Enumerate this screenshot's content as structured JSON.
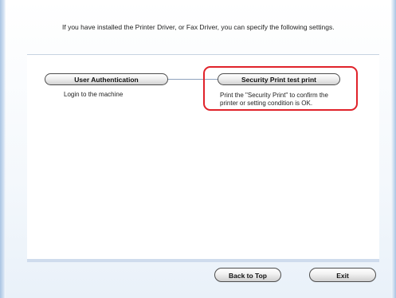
{
  "intro_text": "If you have installed the Printer Driver, or Fax Driver, you can specify the following settings.",
  "steps": [
    {
      "label": "User Authentication",
      "description": "Login to the machine"
    },
    {
      "label": "Security Print test print",
      "description": "Print the \"Security Print\" to confirm the printer or setting condition is OK."
    }
  ],
  "footer": {
    "back_label": "Back to Top",
    "exit_label": "Exit"
  },
  "colors": {
    "highlight": "#e0222a",
    "connector": "#8fa3bd"
  }
}
